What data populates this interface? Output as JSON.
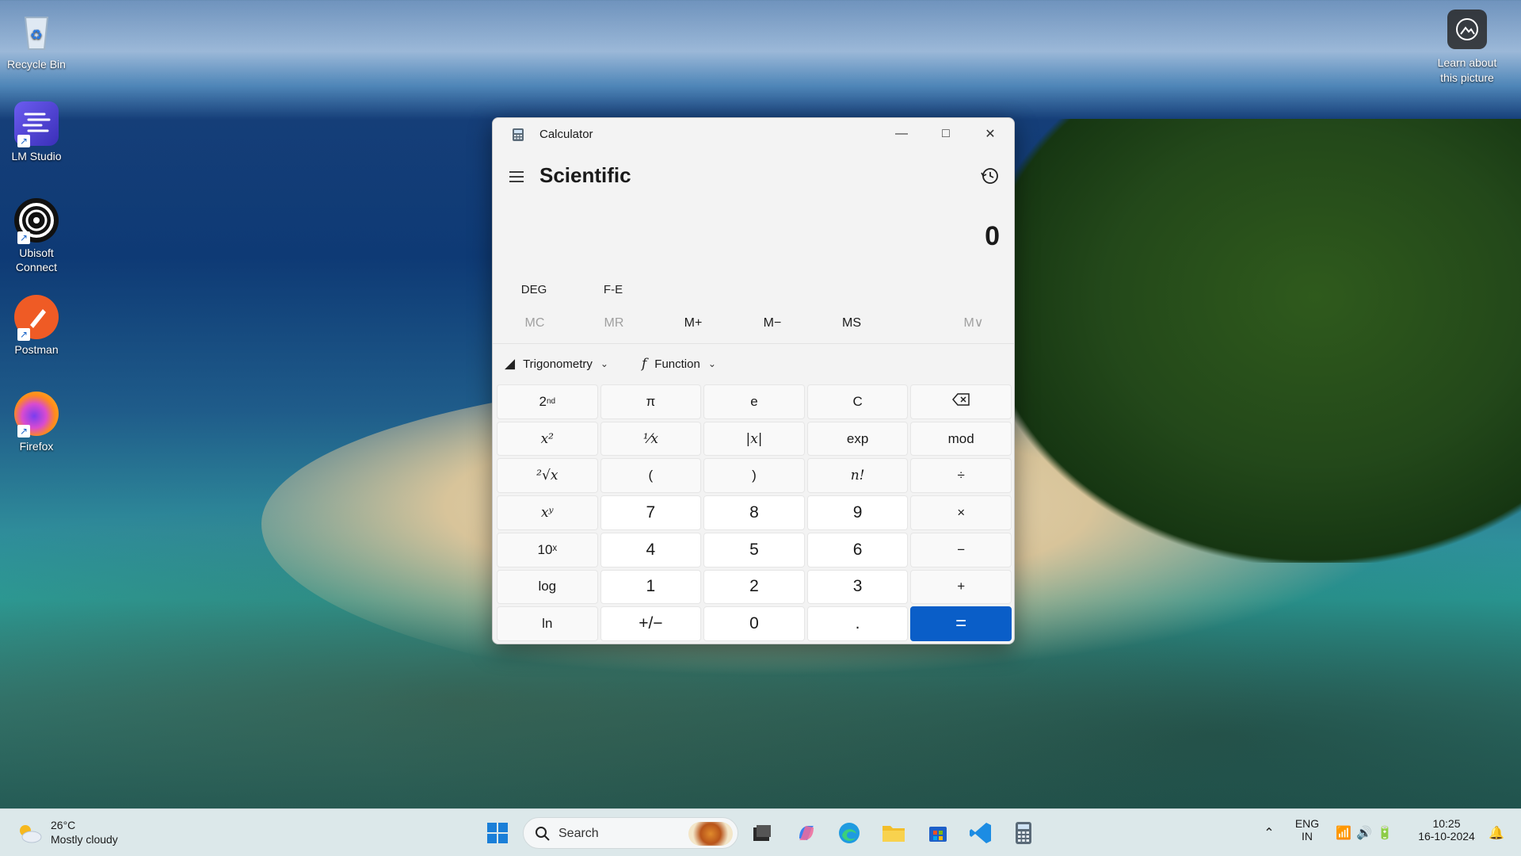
{
  "desktop": {
    "icons": [
      {
        "label": "Recycle Bin"
      },
      {
        "label": "LM Studio"
      },
      {
        "label": "Ubisoft Connect"
      },
      {
        "label": "Postman"
      },
      {
        "label": "Firefox"
      }
    ],
    "learn_label": "Learn about this picture"
  },
  "window": {
    "title": "Calculator",
    "mode": "Scientific",
    "display_value": "0",
    "angle_mode": "DEG",
    "fe_label": "F-E",
    "memory": [
      "MC",
      "MR",
      "M+",
      "M−",
      "MS",
      "M∨"
    ],
    "trig_label": "Trigonometry",
    "function_label": "Function",
    "keys": [
      [
        "2nd",
        "π",
        "e",
        "C",
        "⌫"
      ],
      [
        "x²",
        "¹⁄x",
        "|x|",
        "exp",
        "mod"
      ],
      [
        "²√x",
        "(",
        ")",
        "n!",
        "÷"
      ],
      [
        "xʸ",
        "7",
        "8",
        "9",
        "×"
      ],
      [
        "10ˣ",
        "4",
        "5",
        "6",
        "−"
      ],
      [
        "log",
        "1",
        "2",
        "3",
        "+"
      ],
      [
        "ln",
        "+/−",
        "0",
        ".",
        "="
      ]
    ]
  },
  "taskbar": {
    "weather_temp": "26°C",
    "weather_desc": "Mostly cloudy",
    "search_placeholder": "Search",
    "lang_top": "ENG",
    "lang_bottom": "IN",
    "time": "10:25",
    "date": "16-10-2024"
  },
  "colors": {
    "accent": "#0a5ec8",
    "taskbar_bg": "#dce8ea",
    "window_bg": "#f3f3f3"
  }
}
